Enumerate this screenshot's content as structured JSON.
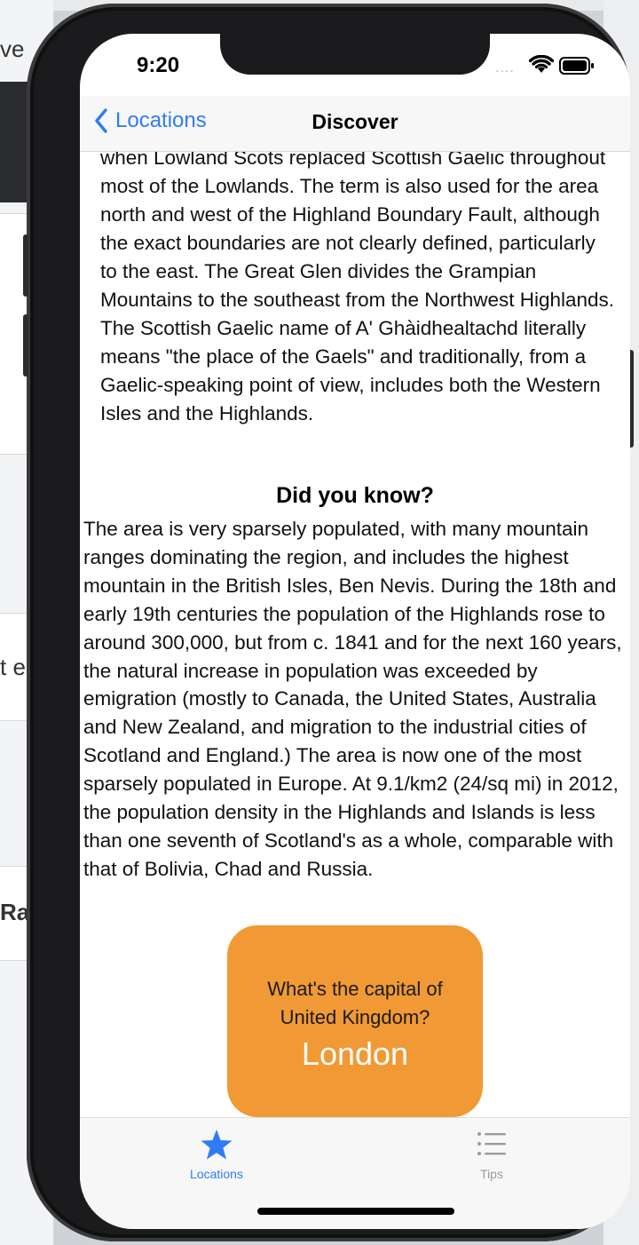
{
  "status_bar": {
    "time": "9:20",
    "signal": "...."
  },
  "nav": {
    "back_label": "Locations",
    "title": "Discover"
  },
  "content": {
    "intro_text": "when Lowland Scots replaced Scottish Gaelic throughout most of the Lowlands. The term is also used for the area north and west of the Highland Boundary Fault, although the exact boundaries are not clearly defined, particularly to the east. The Great Glen divides the Grampian Mountains to the southeast from the Northwest Highlands. The Scottish Gaelic name of A' Ghàidhealtachd literally means \"the place of the Gaels\" and traditionally, from a Gaelic-speaking point of view, includes both the Western Isles and the Highlands.",
    "did_you_know_heading": "Did you know?",
    "did_you_know_text": "The area is very sparsely populated, with many mountain ranges dominating the region, and includes the highest mountain in the British Isles, Ben Nevis. During the 18th and early 19th centuries the population of the Highlands rose to around 300,000, but from c. 1841 and for the next 160 years, the natural increase in population was exceeded by emigration (mostly to Canada, the United States, Australia and New Zealand, and migration to the industrial cities of Scotland and England.) The area is now one of the most sparsely populated in Europe. At 9.1/km2 (24/sq mi) in 2012, the population density in the Highlands and Islands is less than one seventh of Scotland's as a whole, comparable with that of Bolivia, Chad and Russia."
  },
  "quiz": {
    "question": "What's the capital of United Kingdom?",
    "answer": "London",
    "color": "#f19a35"
  },
  "tab_bar": {
    "tabs": [
      {
        "label": "Locations",
        "icon": "star-icon",
        "selected": true
      },
      {
        "label": "Tips",
        "icon": "list-icon",
        "selected": false
      }
    ]
  },
  "background_fragments": {
    "frag1": "ve",
    "frag2": "t e",
    "frag3": "Rav"
  },
  "colors": {
    "accent": "#2f7cf6",
    "inactive": "#9a9aa0"
  }
}
